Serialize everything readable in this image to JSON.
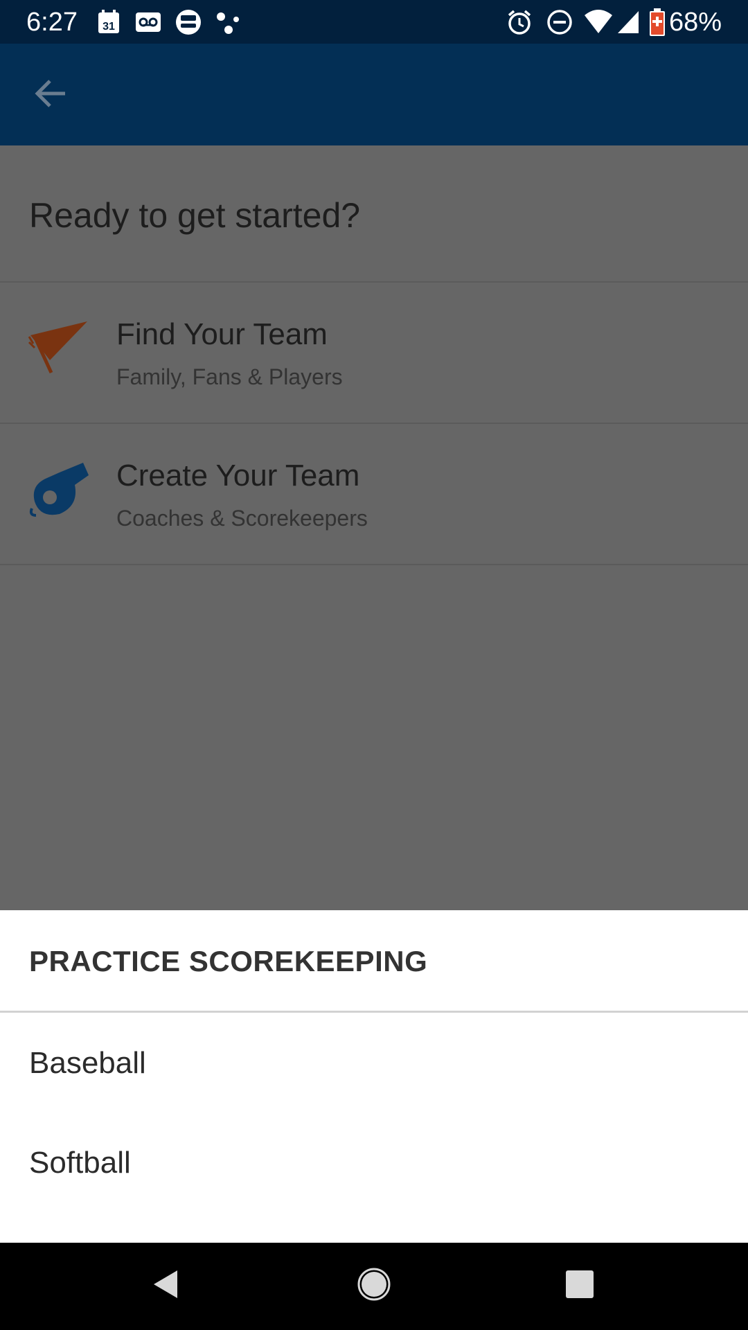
{
  "status_bar": {
    "time": "6:27",
    "battery_percent": "68%",
    "icons": [
      "calendar-icon",
      "voicemail-icon",
      "bus-icon",
      "dots-icon",
      "alarm-icon",
      "do-not-disturb-icon",
      "wifi-icon",
      "signal-icon",
      "battery-icon"
    ],
    "calendar_day": "31"
  },
  "app_bar": {
    "back_icon": "arrow-left-icon"
  },
  "page": {
    "title": "Ready to get started?",
    "options": [
      {
        "title": "Find Your Team",
        "subtitle": "Family, Fans & Players",
        "icon": "pennant-icon",
        "icon_color": "#7a3310"
      },
      {
        "title": "Create Your Team",
        "subtitle": "Coaches & Scorekeepers",
        "icon": "whistle-icon",
        "icon_color": "#0a3a66"
      }
    ]
  },
  "sheet": {
    "title": "PRACTICE SCOREKEEPING",
    "items": [
      {
        "label": "Baseball"
      },
      {
        "label": "Softball"
      }
    ]
  },
  "nav_bar": {
    "icons": [
      "back-triangle-icon",
      "home-circle-icon",
      "recents-square-icon"
    ]
  },
  "colors": {
    "status_bar": "#02203d",
    "app_bar": "#032f55",
    "scrim": "#666666"
  }
}
